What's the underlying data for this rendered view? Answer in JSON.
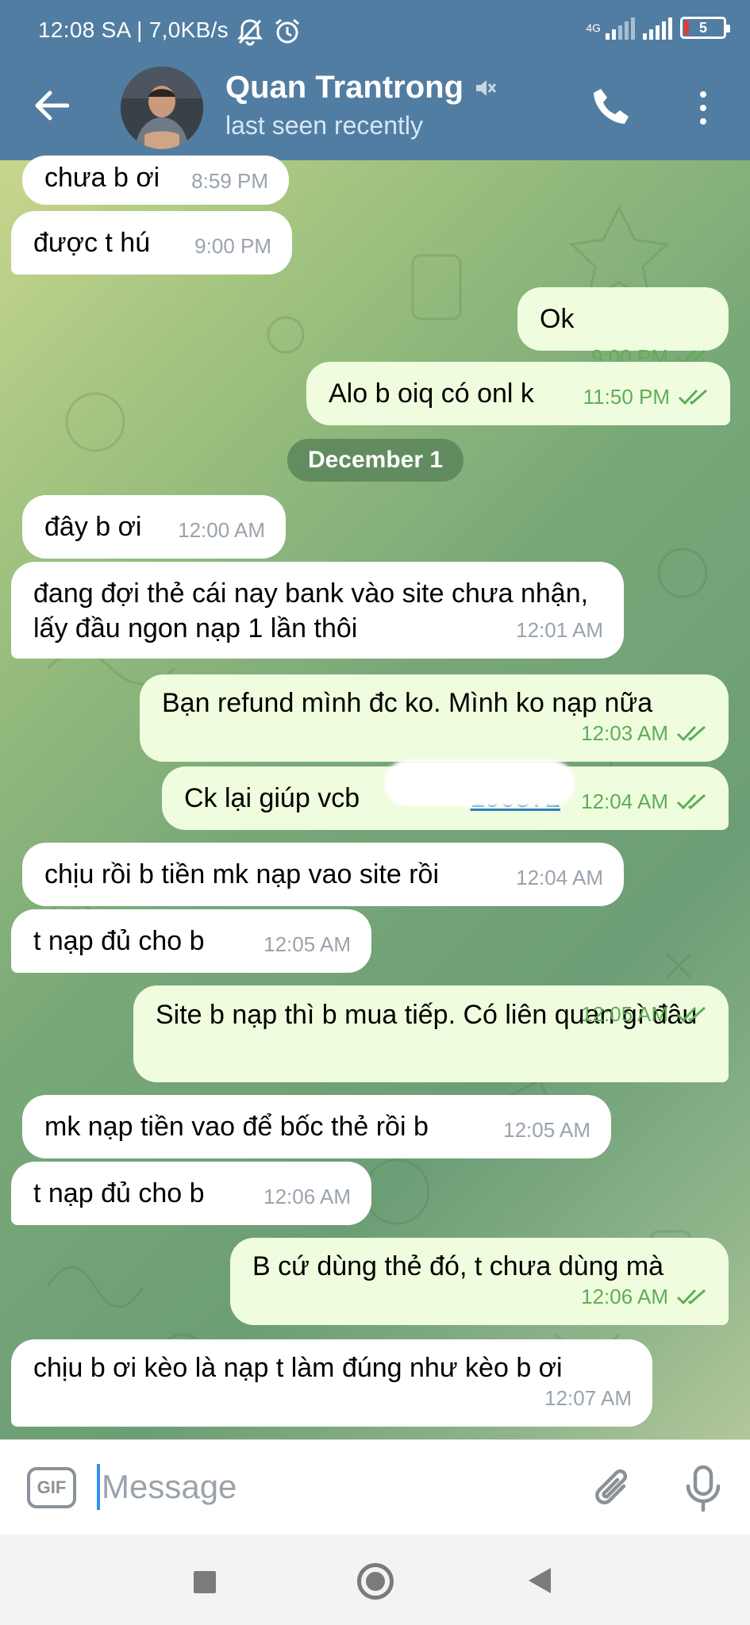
{
  "status": {
    "time": "12:08 SA | 7,0KB/s",
    "network": "4G",
    "battery": "5"
  },
  "header": {
    "title": "Quan Trantrong",
    "subtitle": "last seen recently"
  },
  "date_separator": "December 1",
  "messages": [
    {
      "dir": "in",
      "text": "chưa b ơi",
      "time": "8:59 PM"
    },
    {
      "dir": "in",
      "text": "được t hú",
      "time": "9:00 PM"
    },
    {
      "dir": "out",
      "text": "Ok",
      "time": "9:00 PM"
    },
    {
      "dir": "out",
      "text": "Alo b oiq có onl k",
      "time": "11:50 PM"
    },
    {
      "dir": "in",
      "text": "đây b ơi",
      "time": "12:00 AM"
    },
    {
      "dir": "in",
      "text": "đang đợi thẻ cái nay bank vào site chưa nhận, lấy đầu ngon nạp 1 lần thôi",
      "time": "12:01 AM"
    },
    {
      "dir": "out",
      "text": "Bạn refund mình đc ko. Mình ko nạp nữa",
      "time": "12:03 AM"
    },
    {
      "dir": "out",
      "text": "Ck lại giúp vcb",
      "link": "190872",
      "time": "12:04 AM"
    },
    {
      "dir": "in",
      "text": "chịu rồi b tiền mk nạp vao site rồi",
      "time": "12:04 AM"
    },
    {
      "dir": "in",
      "text": "t nạp đủ cho b",
      "time": "12:05 AM"
    },
    {
      "dir": "out",
      "text": "Site b nạp thì b mua tiếp. Có liên quan gì đâu",
      "time": "12:05 AM"
    },
    {
      "dir": "in",
      "text": "mk nạp tiền vao để bốc thẻ rồi b",
      "time": "12:05 AM"
    },
    {
      "dir": "in",
      "text": "t nạp đủ cho b",
      "time": "12:06 AM"
    },
    {
      "dir": "out",
      "text": "B cứ dùng thẻ đó, t chưa dùng mà",
      "time": "12:06 AM"
    },
    {
      "dir": "in",
      "text": "chịu b ơi kèo là nạp t làm đúng như kèo b ơi",
      "time": "12:07 AM"
    }
  ],
  "composer": {
    "gif_label": "GIF",
    "placeholder": "Message"
  },
  "icons": {
    "back": "back-arrow-icon",
    "mute": "muted-speaker-icon",
    "call": "phone-icon",
    "menu": "more-vertical-icon",
    "attach": "paperclip-icon",
    "mic": "microphone-icon"
  },
  "colors": {
    "header": "#517da2",
    "incoming_bubble": "#ffffff",
    "outgoing_bubble": "#effdde",
    "outgoing_meta": "#5fad59",
    "link": "#2b7cc2"
  }
}
